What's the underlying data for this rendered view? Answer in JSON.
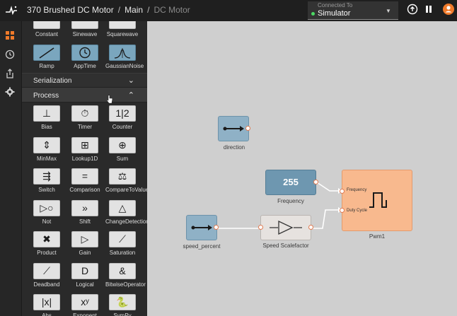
{
  "header": {
    "crumbs": [
      "370 Brushed DC Motor",
      "Main",
      "DC Motor"
    ],
    "connection_label": "Connected To",
    "connection_value": "Simulator"
  },
  "palette": {
    "top_row": [
      {
        "label": "Constant"
      },
      {
        "label": "Sinewave"
      },
      {
        "label": "Squarewave"
      }
    ],
    "gen_row": [
      {
        "label": "Ramp",
        "icon": "ramp-icon"
      },
      {
        "label": "AppTime",
        "icon": "clock-icon"
      },
      {
        "label": "GaussianNoise",
        "icon": "gaussian-icon"
      }
    ],
    "sections": [
      {
        "title": "Serialization",
        "chevron": "⌄"
      },
      {
        "title": "Process",
        "chevron": "⌃"
      }
    ],
    "process_blocks": [
      {
        "label": "Bias",
        "glyph": "⊥"
      },
      {
        "label": "Timer",
        "glyph": "⏱"
      },
      {
        "label": "Counter",
        "glyph": "1|2"
      },
      {
        "label": "MinMax",
        "glyph": "⇕"
      },
      {
        "label": "Lookup1D",
        "glyph": "⊞"
      },
      {
        "label": "Sum",
        "glyph": "⊕"
      },
      {
        "label": "Switch",
        "glyph": "⇶"
      },
      {
        "label": "Comparison",
        "glyph": "="
      },
      {
        "label": "CompareToValue",
        "glyph": "⚖"
      },
      {
        "label": "Not",
        "glyph": "▷○"
      },
      {
        "label": "Shift",
        "glyph": "»"
      },
      {
        "label": "ChangeDetection",
        "glyph": "△"
      },
      {
        "label": "Product",
        "glyph": "✖"
      },
      {
        "label": "Gain",
        "glyph": "▷"
      },
      {
        "label": "Saturation",
        "glyph": "⟋"
      },
      {
        "label": "Deadband",
        "glyph": "⟋"
      },
      {
        "label": "Logical",
        "glyph": "D"
      },
      {
        "label": "BitwiseOperator",
        "glyph": "&"
      },
      {
        "label": "Abs",
        "glyph": "|x|"
      },
      {
        "label": "Exponent",
        "glyph": "xʸ"
      },
      {
        "label": "SymPy",
        "glyph": "🐍"
      }
    ]
  },
  "canvas": {
    "nodes": {
      "direction": {
        "label": "direction"
      },
      "frequency": {
        "label": "Frequency",
        "value": "255"
      },
      "speed_percent": {
        "label": "speed_percent"
      },
      "scalefactor": {
        "label": "Speed Scalefactor"
      },
      "pwm": {
        "label": "Pwm1",
        "in1": "Frequency",
        "in2": "Duty Cycle"
      }
    }
  }
}
